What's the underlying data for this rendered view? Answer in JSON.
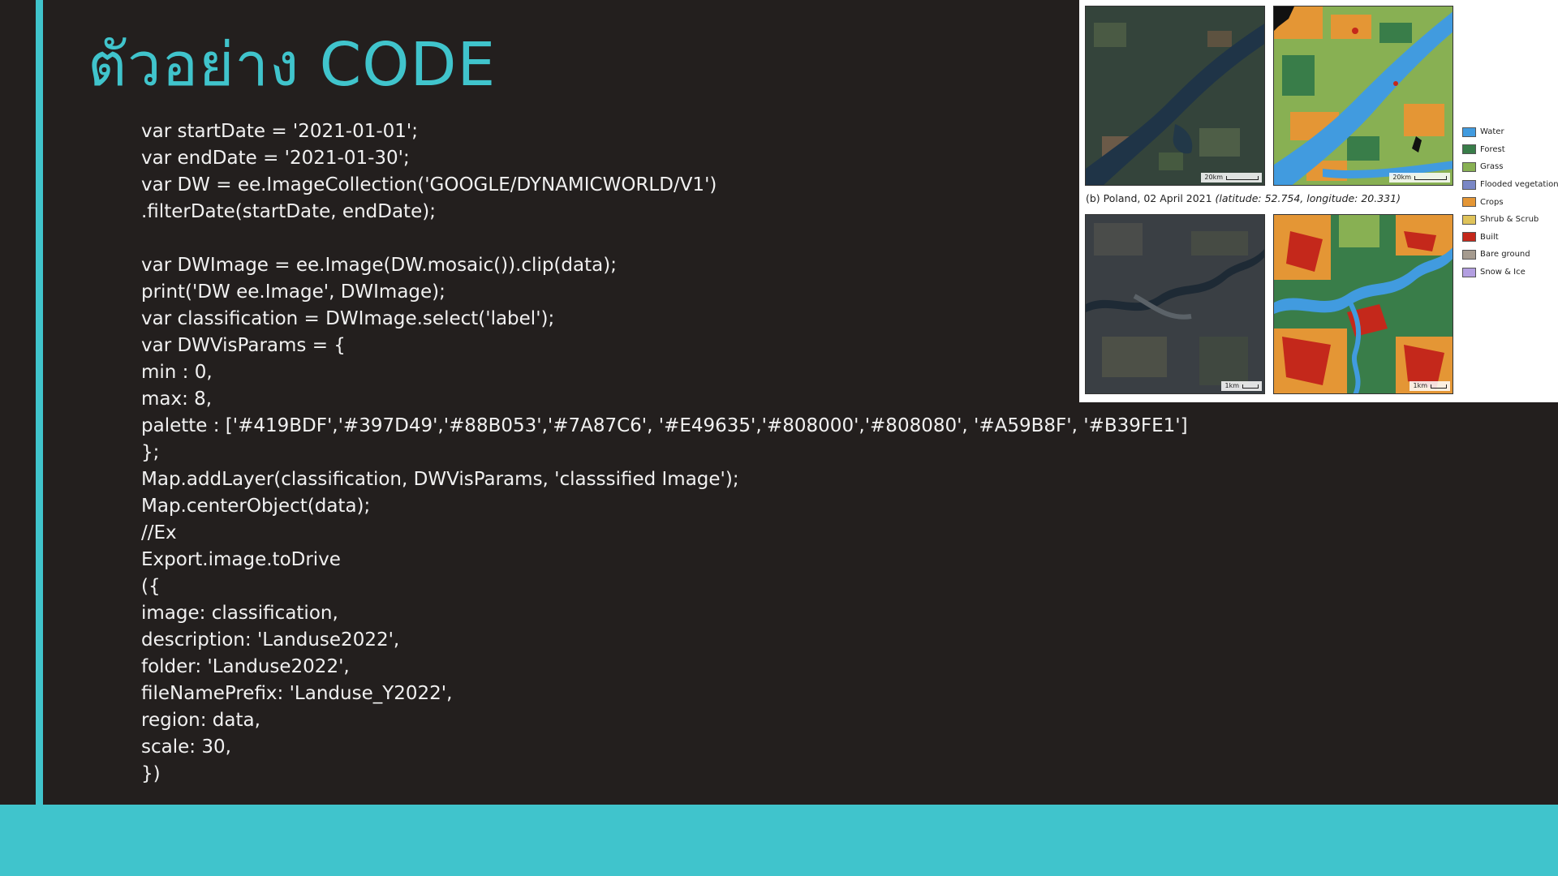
{
  "slide": {
    "title": "ตัวอย่าง CODE",
    "colors": {
      "background": "#231f1e",
      "accent": "#40c4cc",
      "code_text": "#f1f1f1"
    }
  },
  "code_lines": [
    "var startDate = '2021-01-01';",
    "var endDate = '2021-01-30';",
    "var DW = ee.ImageCollection('GOOGLE/DYNAMICWORLD/V1')",
    ".filterDate(startDate, endDate);",
    "",
    "var DWImage = ee.Image(DW.mosaic()).clip(data);",
    "print('DW ee.Image', DWImage);",
    "var classification = DWImage.select('label');",
    "var DWVisParams = {",
    "min : 0,",
    "max: 8,",
    "palette : ['#419BDF','#397D49','#88B053','#7A87C6', '#E49635','#808000','#808080', '#A59B8F', '#B39FE1']",
    "};",
    "Map.addLayer(classification, DWVisParams, 'classsified Image');",
    "Map.centerObject(data);",
    "//Ex",
    "Export.image.toDrive",
    "({",
    "image: classification,",
    "description: 'Landuse2022',",
    "folder: 'Landuse2022',",
    "fileNamePrefix: 'Landuse_Y2022',",
    "region: data,",
    "scale: 30,",
    "})"
  ],
  "figure": {
    "caption_prefix": "(b) Poland, 02 April 2021 ",
    "caption_coords": "(latitude: 52.754, longitude: 20.331)",
    "scale_labels": {
      "top_left": "20km",
      "top_right": "20km",
      "bottom_left": "1km",
      "bottom_right": "1km"
    },
    "legend": [
      {
        "label": "Water",
        "color": "#419BDF"
      },
      {
        "label": "Forest",
        "color": "#397D49"
      },
      {
        "label": "Grass",
        "color": "#88B053"
      },
      {
        "label": "Flooded vegetation",
        "color": "#7A87C6"
      },
      {
        "label": "Crops",
        "color": "#E49635"
      },
      {
        "label": "Shrub & Scrub",
        "color": "#DFC35A"
      },
      {
        "label": "Built",
        "color": "#C4281B"
      },
      {
        "label": "Bare ground",
        "color": "#A59B8F"
      },
      {
        "label": "Snow & Ice",
        "color": "#B39FE1"
      }
    ]
  }
}
